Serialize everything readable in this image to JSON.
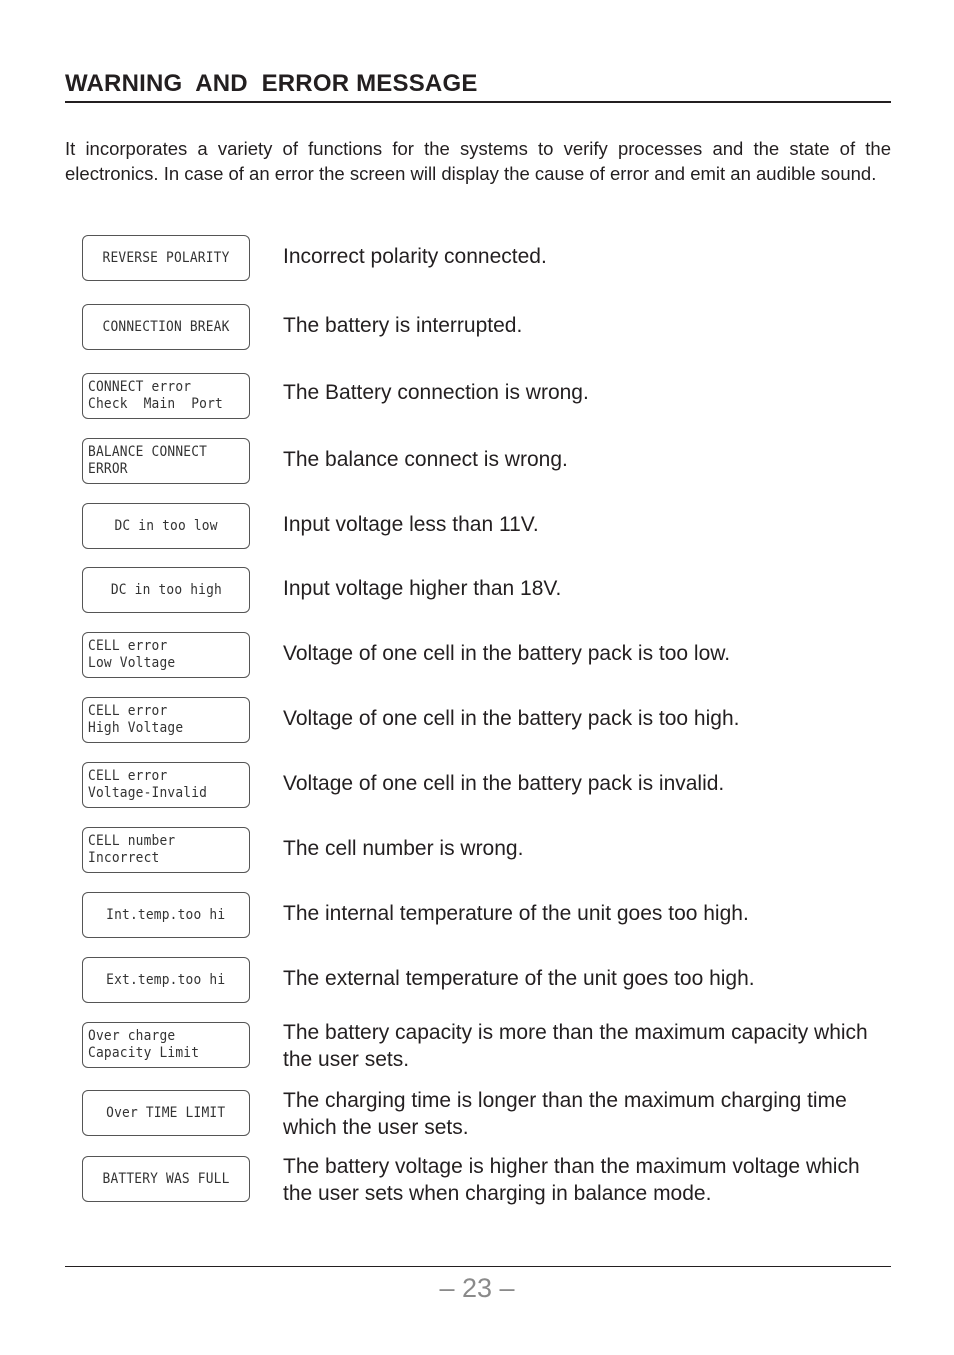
{
  "page": {
    "title": "WARNING  AND  ERROR MESSAGE",
    "intro": "It incorporates a variety of functions for the systems to verify processes and the state of the electronics. In case of an error the screen will display the cause of error and emit an audible sound.",
    "page_number": "– 23 –"
  },
  "messages": [
    {
      "display": [
        "REVERSE POLARITY"
      ],
      "description": "Incorrect polarity connected."
    },
    {
      "display": [
        "CONNECTION BREAK"
      ],
      "description": "The battery is interrupted."
    },
    {
      "display": [
        "CONNECT error",
        "Check  Main  Port"
      ],
      "description": "The Battery connection is wrong."
    },
    {
      "display": [
        "BALANCE CONNECT",
        "ERROR"
      ],
      "description": "The balance connect is wrong."
    },
    {
      "display": [
        "DC in too low"
      ],
      "description": "Input voltage less than 11V."
    },
    {
      "display": [
        "DC in too high"
      ],
      "description": "Input voltage higher than 18V."
    },
    {
      "display": [
        "CELL error",
        "Low Voltage"
      ],
      "description": "Voltage of one cell in the battery pack is too low."
    },
    {
      "display": [
        "CELL error",
        "High Voltage"
      ],
      "description": "Voltage of one cell in the battery pack is too high."
    },
    {
      "display": [
        "CELL error",
        "Voltage-Invalid"
      ],
      "description": "Voltage of one cell in the battery pack is invalid."
    },
    {
      "display": [
        "CELL number",
        "Incorrect"
      ],
      "description": "The cell number is wrong."
    },
    {
      "display": [
        "Int.temp.too hi"
      ],
      "description": "The internal temperature of the unit goes too high."
    },
    {
      "display": [
        "Ext.temp.too hi"
      ],
      "description": "The external temperature of the unit goes too high."
    },
    {
      "display": [
        "Over charge",
        "Capacity Limit"
      ],
      "description": "The battery capacity is more than the maximum capacity which the  user sets."
    },
    {
      "display": [
        "Over TIME LIMIT"
      ],
      "description": "The charging time is longer than the maximum charging time which the  user sets."
    },
    {
      "display": [
        "BATTERY WAS FULL"
      ],
      "description": "The battery voltage is higher than the maximum voltage which the  user sets  when charging in balance mode."
    }
  ]
}
